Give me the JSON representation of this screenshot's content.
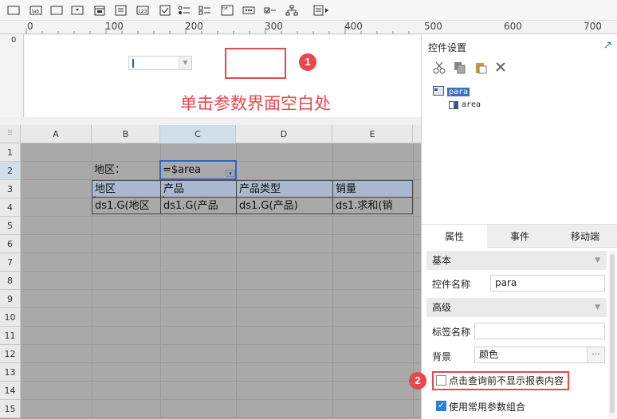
{
  "toolbar": {
    "icons": [
      "text-box-icon",
      "label-icon",
      "combo-box-icon",
      "tree-combo-icon",
      "date-icon",
      "number-icon",
      "radio-group-icon",
      "checkbox-group-icon",
      "text-area-icon",
      "password-icon",
      "checkbox-icon",
      "tree-icon",
      "more-icon"
    ]
  },
  "ruler": {
    "h_labels": [
      "0",
      "100",
      "200",
      "300",
      "400",
      "500",
      "600",
      "700"
    ],
    "v_label": "0"
  },
  "param": {
    "badge1": "1",
    "instruction": "单击参数界面空白处"
  },
  "grid": {
    "columns": [
      "A",
      "B",
      "C",
      "D",
      "E"
    ],
    "rows": [
      "1",
      "2",
      "3",
      "4",
      "5",
      "6",
      "7",
      "8",
      "9",
      "10",
      "11",
      "12",
      "13",
      "14",
      "15"
    ],
    "label_area": "地区：",
    "formula": "=$area",
    "headers": [
      "地区",
      "产品",
      "产品类型",
      "销量"
    ],
    "data": [
      "ds1.G(地区",
      "ds1.G(产品",
      "ds1.G(产品)",
      "ds1.求和(销"
    ]
  },
  "panel": {
    "title": "控件设置",
    "tree": {
      "root": "para",
      "child": "area"
    },
    "tabs": [
      "属性",
      "事件",
      "移动端"
    ],
    "section_basic": "基本",
    "label_widget_name": "控件名称",
    "widget_name_value": "para",
    "section_advanced": "高级",
    "label_tag_name": "标签名称",
    "tag_name_value": "",
    "label_background": "背景",
    "background_value": "颜色",
    "dots": "···",
    "badge2": "2",
    "check_no_display": "点击查询前不显示报表内容",
    "check_common_params": "使用常用参数组合"
  },
  "colors": {
    "accent": "#e5484d",
    "selection": "#2f66c1",
    "header_fill": "#a9b8cf"
  }
}
